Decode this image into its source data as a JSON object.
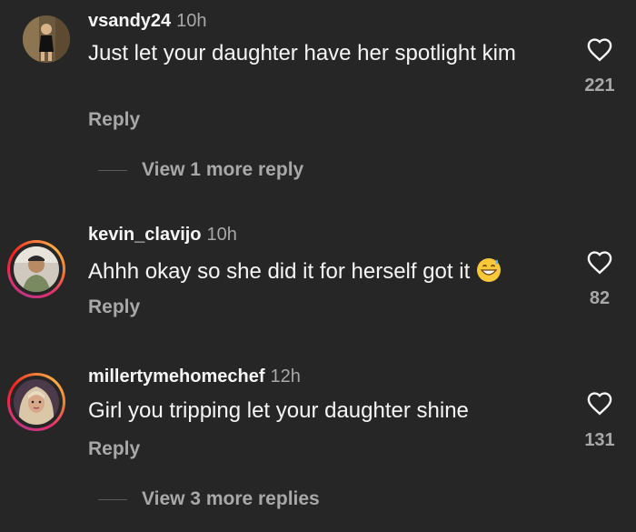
{
  "comments": [
    {
      "username": "vsandy24",
      "time": "10h",
      "text": "Just let your daughter have her spotlight kim",
      "reply_label": "Reply",
      "likes": "221",
      "view_more": "View 1 more reply"
    },
    {
      "username": "kevin_clavijo",
      "time": "10h",
      "text": "Ahhh okay so she did it for herself got it",
      "emoji": "grinning-face-with-sweat-emoji",
      "reply_label": "Reply",
      "likes": "82"
    },
    {
      "username": "millertymehomechef",
      "time": "12h",
      "text": "Girl you tripping let your daughter shine",
      "reply_label": "Reply",
      "likes": "131",
      "view_more": "View 3 more replies"
    }
  ],
  "colors": {
    "background": "#262626",
    "primary_text": "#f5f5f5",
    "secondary_text": "#a8a8a8"
  }
}
